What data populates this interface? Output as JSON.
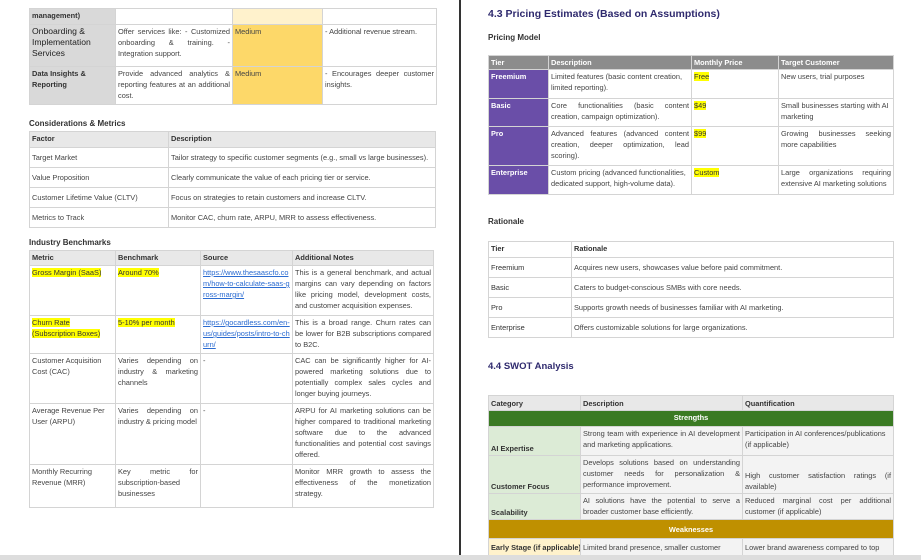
{
  "left_page": {
    "services_table": {
      "rows": [
        {
          "name": "management)",
          "desc": "",
          "level": "",
          "notes": ""
        },
        {
          "name": "Onboarding & Implementation Services",
          "desc": "Offer services like: - Customized onboarding & training. - Integration support.",
          "level": "Medium",
          "notes": "- Additional revenue stream."
        },
        {
          "name": "Data Insights & Reporting",
          "desc": "Provide advanced analytics & reporting features at an additional cost.",
          "level": "Medium",
          "notes": "- Encourages deeper customer insights."
        }
      ]
    },
    "considerations": {
      "title": "Considerations & Metrics",
      "headers": [
        "Factor",
        "Description"
      ],
      "rows": [
        [
          "Target Market",
          "Tailor strategy to specific customer segments (e.g., small vs large businesses)."
        ],
        [
          "Value Proposition",
          "Clearly communicate the value of each pricing tier or service."
        ],
        [
          "Customer Lifetime Value (CLTV)",
          "Focus on strategies to retain customers and increase CLTV."
        ],
        [
          "Metrics to Track",
          "Monitor CAC, churn rate, ARPU, MRR to assess effectiveness."
        ]
      ]
    },
    "benchmarks": {
      "title": "Industry Benchmarks",
      "headers": [
        "Metric",
        "Benchmark",
        "Source",
        "Additional Notes"
      ],
      "rows": [
        [
          "Gross Margin (SaaS)",
          "Around 70%",
          "https://www.thesaascfo.com/how-to-calculate-saas-gross-margin/",
          "This is a general benchmark, and actual margins can vary depending on factors like pricing model, development costs, and customer acquisition expenses."
        ],
        [
          "Churn Rate (Subscription Boxes)",
          "5-10% per month",
          "https://gocardless.com/en-us/guides/posts/intro-to-churn/",
          "This is a broad range. Churn rates can be lower for B2B subscriptions compared to B2C."
        ],
        [
          "Customer Acquisition Cost (CAC)",
          "Varies depending on industry & marketing channels",
          "-",
          "CAC can be significantly higher for AI-powered marketing solutions due to potentially complex sales cycles and longer buying journeys."
        ],
        [
          "Average Revenue Per User (ARPU)",
          "Varies depending on industry & pricing model",
          "-",
          "ARPU for AI marketing solutions can be higher compared to traditional marketing software due to the advanced functionalities and potential cost savings offered."
        ],
        [
          "Monthly Recurring Revenue (MRR)",
          "Key metric for subscription-based businesses",
          "",
          "Monitor MRR growth to assess the effectiveness of the monetization strategy."
        ]
      ]
    }
  },
  "right_page": {
    "pricing_heading": "4.3 Pricing Estimates (Based on Assumptions)",
    "pricing_model": {
      "title": "Pricing Model",
      "headers": [
        "Tier",
        "Description",
        "Monthly Price",
        "Target Customer"
      ],
      "rows": [
        [
          "Freemium",
          "Limited features (basic content creation, limited reporting).",
          "Free",
          "New users, trial purposes"
        ],
        [
          "Basic",
          "Core functionalities (basic content creation, campaign optimization).",
          "$49",
          "Small businesses starting with AI marketing"
        ],
        [
          "Pro",
          "Advanced features (advanced content creation, deeper optimization, lead scoring).",
          "$99",
          "Growing businesses seeking more capabilities"
        ],
        [
          "Enterprise",
          "Custom pricing (advanced functionalities, dedicated support, high-volume data).",
          "Custom",
          "Large organizations requiring extensive AI marketing solutions"
        ]
      ]
    },
    "rationale": {
      "title": "Rationale",
      "headers": [
        "Tier",
        "Rationale"
      ],
      "rows": [
        [
          "Freemium",
          "Acquires new users, showcases value before paid commitment."
        ],
        [
          "Basic",
          "Caters to budget-conscious SMBs with core needs."
        ],
        [
          "Pro",
          "Supports growth needs of businesses familiar with AI marketing."
        ],
        [
          "Enterprise",
          "Offers customizable solutions for large organizations."
        ]
      ]
    },
    "swot_heading": "4.4 SWOT Analysis",
    "swot": {
      "headers": [
        "Category",
        "Description",
        "Quantification"
      ],
      "strengths_label": "Strengths",
      "strengths": [
        [
          "AI Expertise",
          "Strong team with experience in AI development and marketing applications.",
          "Participation in AI conferences/publications (if applicable)"
        ],
        [
          "Customer Focus",
          "Develops solutions based on understanding customer needs for personalization & performance improvement.",
          "High customer satisfaction ratings (if available)"
        ],
        [
          "Scalability",
          "AI solutions have the potential to serve a broader customer base efficiently.",
          "Reduced marginal cost per additional customer (if applicable)"
        ]
      ],
      "weaknesses_label": "Weaknesses",
      "weaknesses": [
        [
          "Early Stage (if applicable)",
          "Limited brand presence, smaller customer",
          "Lower brand awareness compared to top"
        ]
      ]
    }
  },
  "colors": {
    "tier_purple": "#6a4ea8",
    "strength_green": "#3a7a23",
    "weakness_gold": "#bf9000",
    "highlight": "#ffff00",
    "medium_orange": "#fdd869"
  }
}
